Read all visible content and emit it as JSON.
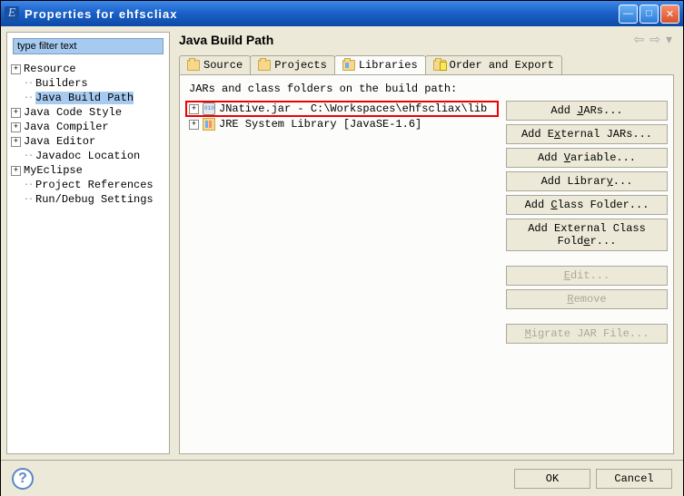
{
  "window": {
    "title": "Properties for ehfscliax"
  },
  "filter": {
    "placeholder": "type filter text"
  },
  "tree": [
    {
      "label": "Resource",
      "expand": "+",
      "level": 0
    },
    {
      "label": "Builders",
      "level": 1
    },
    {
      "label": "Java Build Path",
      "level": 1,
      "selected": true
    },
    {
      "label": "Java Code Style",
      "expand": "+",
      "level": 0
    },
    {
      "label": "Java Compiler",
      "expand": "+",
      "level": 0
    },
    {
      "label": "Java Editor",
      "expand": "+",
      "level": 0
    },
    {
      "label": "Javadoc Location",
      "level": 1
    },
    {
      "label": "MyEclipse",
      "expand": "+",
      "level": 0
    },
    {
      "label": "Project References",
      "level": 1
    },
    {
      "label": "Run/Debug Settings",
      "level": 1
    }
  ],
  "page": {
    "title": "Java Build Path"
  },
  "tabs": {
    "source": "Source",
    "projects": "Projects",
    "libraries": "Libraries",
    "order": "Order and Export"
  },
  "content": {
    "desc": "JARs and class folders on the build path:",
    "items": [
      {
        "label": "JNative.jar - C:\\Workspaces\\ehfscliax\\lib",
        "icon": "jar",
        "highlighted": true
      },
      {
        "label": "JRE System Library [JavaSE-1.6]",
        "icon": "lib"
      }
    ]
  },
  "buttons": {
    "add_jars": "Add JARs...",
    "add_external_jars": "Add External JARs...",
    "add_variable": "Add Variable...",
    "add_library": "Add Library...",
    "add_class_folder": "Add Class Folder...",
    "add_external_class_folder": "Add External Class Folder...",
    "edit": "Edit...",
    "remove": "Remove",
    "migrate": "Migrate JAR File..."
  },
  "footer": {
    "ok": "OK",
    "cancel": "Cancel"
  }
}
